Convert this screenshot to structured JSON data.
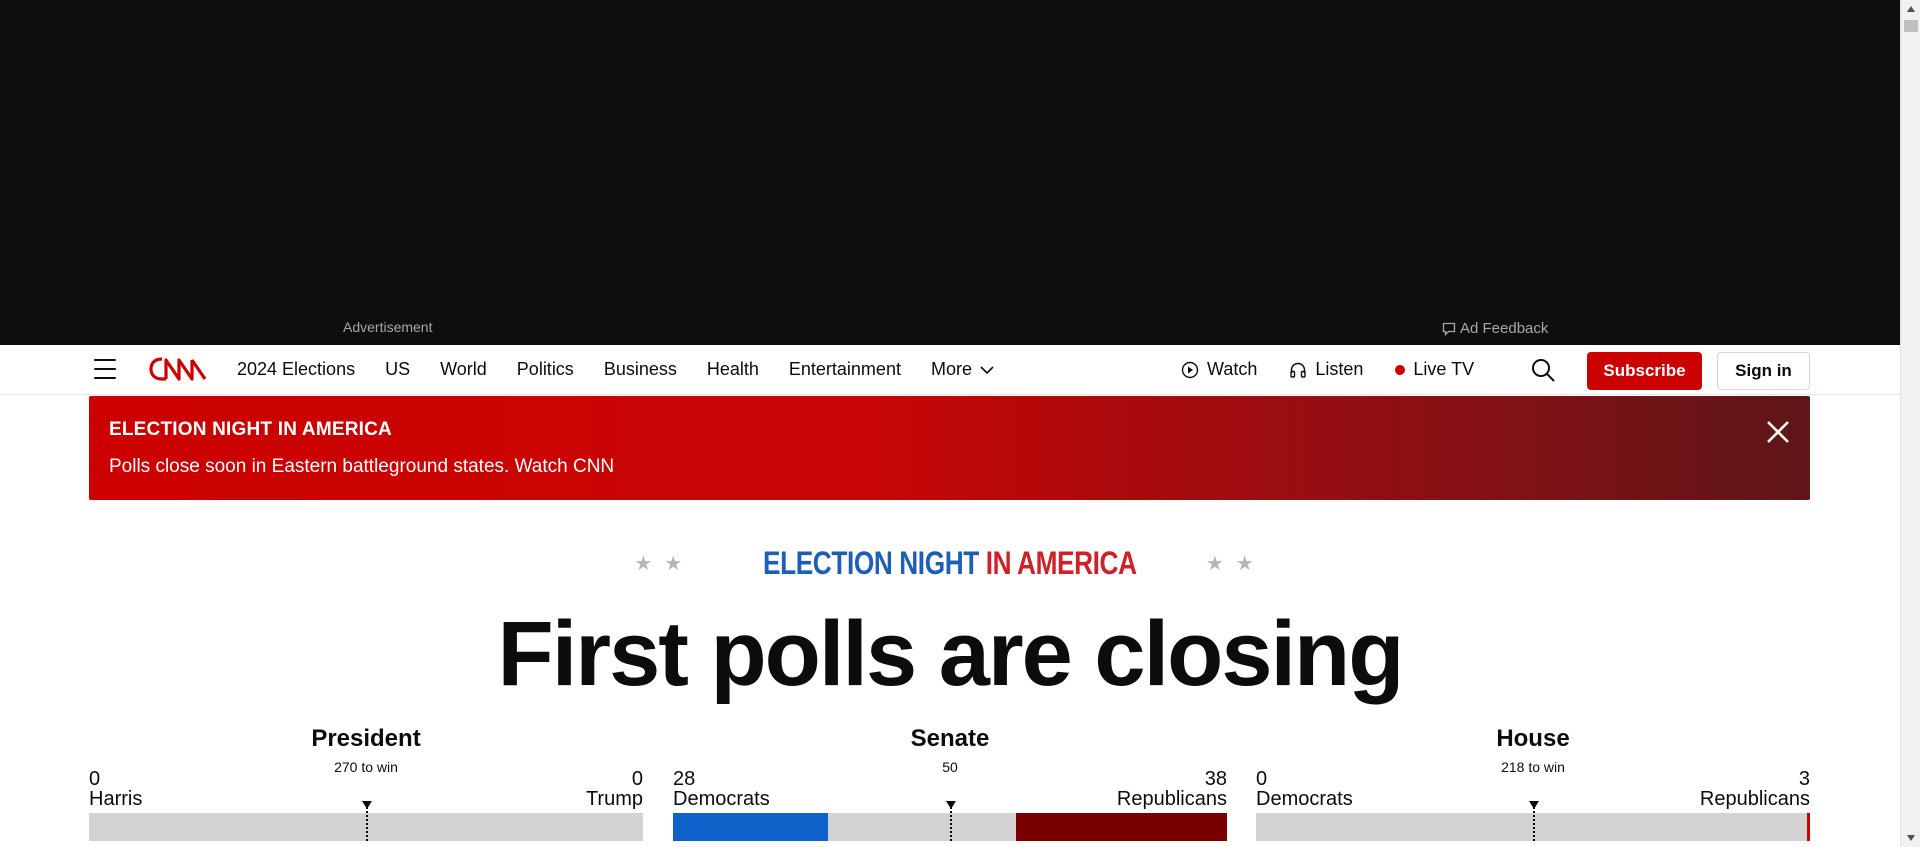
{
  "ad": {
    "label": "Advertisement",
    "feedback": "Ad Feedback"
  },
  "nav": {
    "links": [
      "2024 Elections",
      "US",
      "World",
      "Politics",
      "Business",
      "Health",
      "Entertainment"
    ],
    "more_label": "More",
    "watch": "Watch",
    "listen": "Listen",
    "live_tv": "Live TV",
    "subscribe": "Subscribe",
    "signin": "Sign in"
  },
  "banner": {
    "title": "ELECTION NIGHT IN AMERICA",
    "text": "Polls close soon in Eastern battleground states. Watch CNN"
  },
  "header": {
    "eyebrow_blue": "ELECTION NIGHT",
    "eyebrow_red": " IN AMERICA",
    "headline": "First polls are closing"
  },
  "races": {
    "president": {
      "title": "President",
      "left_count": "0",
      "left_name": "Harris",
      "right_count": "0",
      "right_name": "Trump",
      "to_win": "270 to win",
      "dem_fraction": 0.0,
      "rep_fraction": 0.0,
      "threshold_fraction": 0.5
    },
    "senate": {
      "title": "Senate",
      "left_count": "28",
      "left_name": "Democrats",
      "right_count": "38",
      "right_name": "Republicans",
      "to_win": "50",
      "dem_fraction": 0.28,
      "rep_fraction": 0.38,
      "threshold_fraction": 0.5
    },
    "house": {
      "title": "House",
      "left_count": "0",
      "left_name": "Democrats",
      "right_count": "3",
      "right_name": "Republicans",
      "to_win": "218 to win",
      "dem_fraction": 0.0,
      "rep_fraction": 0.007,
      "threshold_fraction": 0.5
    }
  },
  "colors": {
    "cnn_red": "#cc0000",
    "dem_blue": "#0e62c9",
    "rep_red": "#7a0000"
  }
}
